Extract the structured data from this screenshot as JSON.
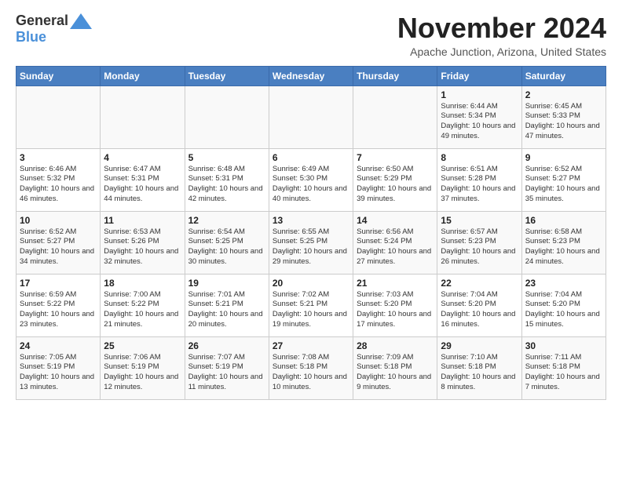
{
  "header": {
    "logo_general": "General",
    "logo_blue": "Blue",
    "month": "November 2024",
    "location": "Apache Junction, Arizona, United States"
  },
  "weekdays": [
    "Sunday",
    "Monday",
    "Tuesday",
    "Wednesday",
    "Thursday",
    "Friday",
    "Saturday"
  ],
  "weeks": [
    [
      {
        "day": "",
        "info": ""
      },
      {
        "day": "",
        "info": ""
      },
      {
        "day": "",
        "info": ""
      },
      {
        "day": "",
        "info": ""
      },
      {
        "day": "",
        "info": ""
      },
      {
        "day": "1",
        "info": "Sunrise: 6:44 AM\nSunset: 5:34 PM\nDaylight: 10 hours\nand 49 minutes."
      },
      {
        "day": "2",
        "info": "Sunrise: 6:45 AM\nSunset: 5:33 PM\nDaylight: 10 hours\nand 47 minutes."
      }
    ],
    [
      {
        "day": "3",
        "info": "Sunrise: 6:46 AM\nSunset: 5:32 PM\nDaylight: 10 hours\nand 46 minutes."
      },
      {
        "day": "4",
        "info": "Sunrise: 6:47 AM\nSunset: 5:31 PM\nDaylight: 10 hours\nand 44 minutes."
      },
      {
        "day": "5",
        "info": "Sunrise: 6:48 AM\nSunset: 5:31 PM\nDaylight: 10 hours\nand 42 minutes."
      },
      {
        "day": "6",
        "info": "Sunrise: 6:49 AM\nSunset: 5:30 PM\nDaylight: 10 hours\nand 40 minutes."
      },
      {
        "day": "7",
        "info": "Sunrise: 6:50 AM\nSunset: 5:29 PM\nDaylight: 10 hours\nand 39 minutes."
      },
      {
        "day": "8",
        "info": "Sunrise: 6:51 AM\nSunset: 5:28 PM\nDaylight: 10 hours\nand 37 minutes."
      },
      {
        "day": "9",
        "info": "Sunrise: 6:52 AM\nSunset: 5:27 PM\nDaylight: 10 hours\nand 35 minutes."
      }
    ],
    [
      {
        "day": "10",
        "info": "Sunrise: 6:52 AM\nSunset: 5:27 PM\nDaylight: 10 hours\nand 34 minutes."
      },
      {
        "day": "11",
        "info": "Sunrise: 6:53 AM\nSunset: 5:26 PM\nDaylight: 10 hours\nand 32 minutes."
      },
      {
        "day": "12",
        "info": "Sunrise: 6:54 AM\nSunset: 5:25 PM\nDaylight: 10 hours\nand 30 minutes."
      },
      {
        "day": "13",
        "info": "Sunrise: 6:55 AM\nSunset: 5:25 PM\nDaylight: 10 hours\nand 29 minutes."
      },
      {
        "day": "14",
        "info": "Sunrise: 6:56 AM\nSunset: 5:24 PM\nDaylight: 10 hours\nand 27 minutes."
      },
      {
        "day": "15",
        "info": "Sunrise: 6:57 AM\nSunset: 5:23 PM\nDaylight: 10 hours\nand 26 minutes."
      },
      {
        "day": "16",
        "info": "Sunrise: 6:58 AM\nSunset: 5:23 PM\nDaylight: 10 hours\nand 24 minutes."
      }
    ],
    [
      {
        "day": "17",
        "info": "Sunrise: 6:59 AM\nSunset: 5:22 PM\nDaylight: 10 hours\nand 23 minutes."
      },
      {
        "day": "18",
        "info": "Sunrise: 7:00 AM\nSunset: 5:22 PM\nDaylight: 10 hours\nand 21 minutes."
      },
      {
        "day": "19",
        "info": "Sunrise: 7:01 AM\nSunset: 5:21 PM\nDaylight: 10 hours\nand 20 minutes."
      },
      {
        "day": "20",
        "info": "Sunrise: 7:02 AM\nSunset: 5:21 PM\nDaylight: 10 hours\nand 19 minutes."
      },
      {
        "day": "21",
        "info": "Sunrise: 7:03 AM\nSunset: 5:20 PM\nDaylight: 10 hours\nand 17 minutes."
      },
      {
        "day": "22",
        "info": "Sunrise: 7:04 AM\nSunset: 5:20 PM\nDaylight: 10 hours\nand 16 minutes."
      },
      {
        "day": "23",
        "info": "Sunrise: 7:04 AM\nSunset: 5:20 PM\nDaylight: 10 hours\nand 15 minutes."
      }
    ],
    [
      {
        "day": "24",
        "info": "Sunrise: 7:05 AM\nSunset: 5:19 PM\nDaylight: 10 hours\nand 13 minutes."
      },
      {
        "day": "25",
        "info": "Sunrise: 7:06 AM\nSunset: 5:19 PM\nDaylight: 10 hours\nand 12 minutes."
      },
      {
        "day": "26",
        "info": "Sunrise: 7:07 AM\nSunset: 5:19 PM\nDaylight: 10 hours\nand 11 minutes."
      },
      {
        "day": "27",
        "info": "Sunrise: 7:08 AM\nSunset: 5:18 PM\nDaylight: 10 hours\nand 10 minutes."
      },
      {
        "day": "28",
        "info": "Sunrise: 7:09 AM\nSunset: 5:18 PM\nDaylight: 10 hours\nand 9 minutes."
      },
      {
        "day": "29",
        "info": "Sunrise: 7:10 AM\nSunset: 5:18 PM\nDaylight: 10 hours\nand 8 minutes."
      },
      {
        "day": "30",
        "info": "Sunrise: 7:11 AM\nSunset: 5:18 PM\nDaylight: 10 hours\nand 7 minutes."
      }
    ]
  ]
}
